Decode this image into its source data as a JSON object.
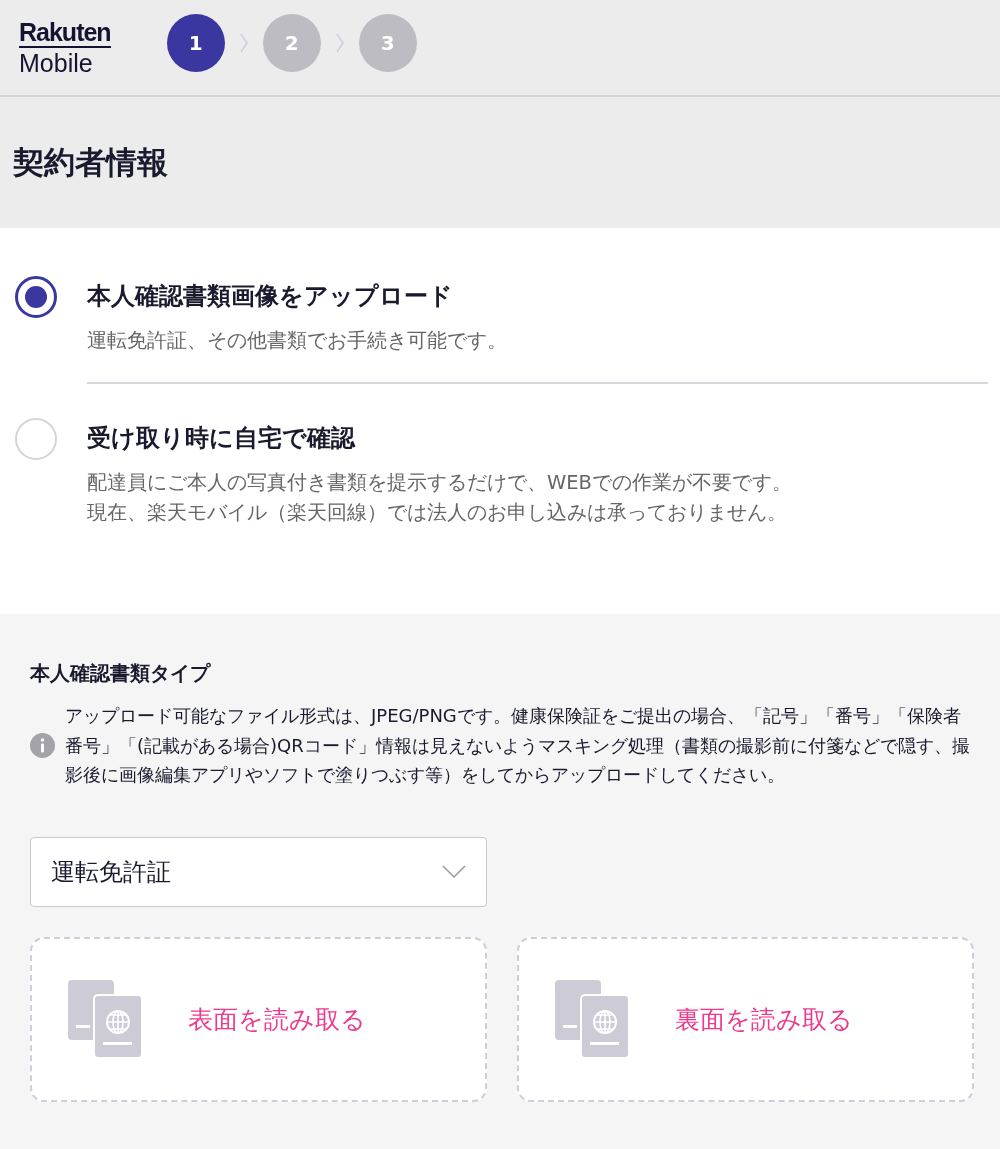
{
  "header": {
    "logo": {
      "line_1": "Rakuten",
      "line_2": "Mobile"
    },
    "steps": [
      {
        "label": "1",
        "selected": true
      },
      {
        "label": "2",
        "selected": false
      },
      {
        "label": "3",
        "selected": false
      }
    ]
  },
  "page_title": "契約者情報",
  "verification_options": [
    {
      "label": "本人確認書類画像をアップロード",
      "selected": true,
      "description": [
        "運転免許証、その他書類でお手続き可能です。"
      ]
    },
    {
      "label": "受け取り時に自宅で確認",
      "selected": false,
      "description": [
        "配達員にご本人の写真付き書類を提示するだけで、WEBでの作業が不要です。",
        "現在、楽天モバイル（楽天回線）では法人のお申し込みは承っておりません。"
      ]
    }
  ],
  "document_section": {
    "heading": "本人確認書類タイプ",
    "notice": "アップロード可能なファイル形式は、JPEG/PNGです。健康保険証をご提出の場合、「記号」「番号」「保険者番号」「(記載がある場合)QRコード」情報は見えないようマスキング処理（書類の撮影前に付箋などで隠す、撮影後に画像編集アプリやソフトで塗りつぶす等）をしてからアップロードしてください。",
    "document_type": {
      "value": "運転免許証"
    },
    "upload_buttons": [
      {
        "label": "表面を読み取る"
      },
      {
        "label": "裏面を読み取る"
      }
    ]
  }
}
